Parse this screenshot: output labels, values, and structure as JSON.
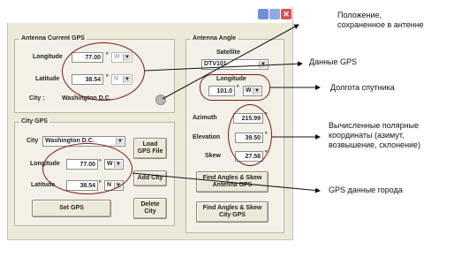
{
  "window": {
    "colors": {
      "frame": "#ece9d8",
      "close": "#d9534f",
      "minmax": "#6f8fd8"
    }
  },
  "antenna_current_gps": {
    "title": "Antenna Current GPS",
    "longitude_label": "Longitude",
    "longitude_value": "77.00",
    "longitude_dir": "W",
    "latitude_label": "Latitude",
    "latitude_value": "38.54",
    "latitude_dir": "N",
    "city_label": "City :",
    "city_value": "Washington D.C."
  },
  "city_gps": {
    "title": "City GPS",
    "city_label": "City",
    "city_value": "Washington D.C.",
    "longitude_label": "Longitude",
    "longitude_value": "77.00",
    "longitude_dir": "W",
    "latitude_label": "Latitude",
    "latitude_value": "38.54",
    "latitude_dir": "N",
    "load_gps_file": "Load\nGPS File",
    "add_city": "Add City",
    "set_gps": "Set GPS",
    "delete_city": "Delete\nCity"
  },
  "antenna_angle": {
    "title": "Antenna Angle",
    "satellite_label": "Satellite",
    "satellite_value": "DTV101",
    "longitude_label": "Longitude",
    "longitude_value": "101.0",
    "longitude_dir": "W",
    "azimuth_label": "Azimuth",
    "azimuth_value": "215.99",
    "elevation_label": "Elevation",
    "elevation_value": "39.50",
    "skew_label": "Skew",
    "skew_value": "27.58",
    "find_antenna_btn": "Find Angles & Skew\nAntenna GPS",
    "find_city_btn": "Find Angles & Skew\nCity GPS"
  },
  "degree_symbol": "º",
  "annotations": {
    "saved_position": "Положение,\nсохраненное в антенне",
    "gps_data": "Данные GPS",
    "satellite_longitude": "Долгота спутника",
    "computed_coords": "Вычисленные полярные\nкоординаты (азимут,\nвозвышение, склонение)",
    "city_gps_data": "GPS данные города"
  }
}
